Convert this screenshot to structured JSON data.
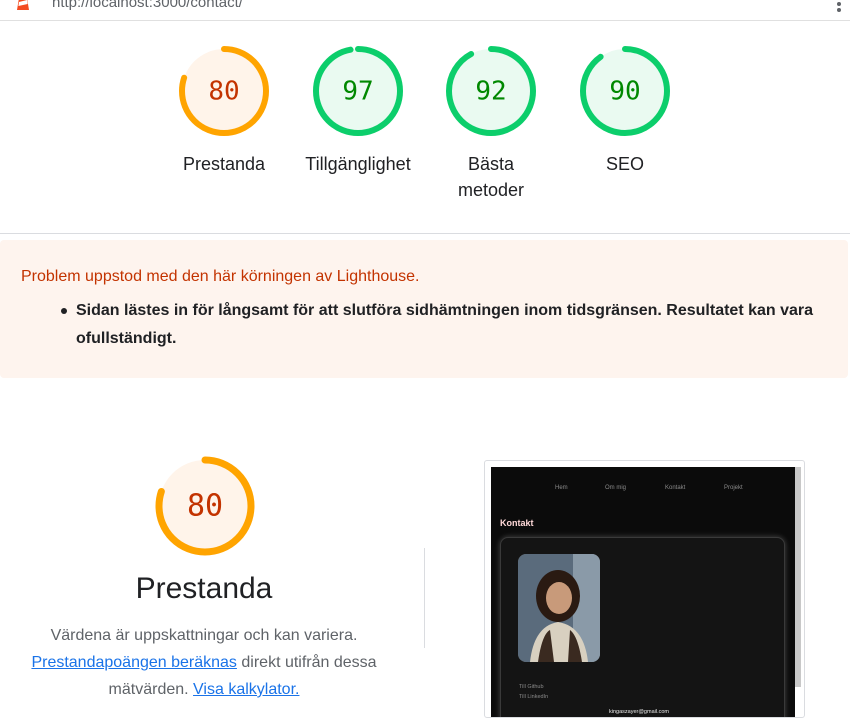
{
  "browser": {
    "url": "http://localhost:3000/contact/"
  },
  "scores": [
    {
      "label": "Prestanda",
      "score": "80",
      "value": 80,
      "color": "#ffa400",
      "text_color": "#c33300",
      "bg": "#fff4ea"
    },
    {
      "label": "Tillgänglighet",
      "score": "97",
      "value": 97,
      "color": "#0cce6b",
      "text_color": "#008800",
      "bg": "#eafaf1"
    },
    {
      "label": "Bästa\nmetoder",
      "score": "92",
      "value": 92,
      "color": "#0cce6b",
      "text_color": "#008800",
      "bg": "#eafaf1"
    },
    {
      "label": "SEO",
      "score": "90",
      "value": 90,
      "color": "#0cce6b",
      "text_color": "#008800",
      "bg": "#eafaf1"
    }
  ],
  "warning": {
    "title": "Problem uppstod med den här körningen av Lighthouse.",
    "items": [
      "Sidan lästes in för långsamt för att slutföra sidhämtningen inom tidsgränsen. Resultatet kan vara ofullständigt."
    ]
  },
  "performance": {
    "score": "80",
    "value": 80,
    "title": "Prestanda",
    "desc_1": "Värdena är uppskattningar och kan variera.",
    "link_1": "Prestandapoängen beräknas",
    "desc_2": " direkt utifrån dessa",
    "desc_3": "mätvärden. ",
    "link_2": "Visa kalkylator."
  },
  "thumbnail": {
    "nav": [
      "Hem",
      "Om mig",
      "Kontakt",
      "Projekt"
    ],
    "heading": "Kontakt",
    "link_github": "Till Github",
    "link_linkedin": "Till LinkedIn",
    "email": "kingaszayer@gmail.com"
  }
}
